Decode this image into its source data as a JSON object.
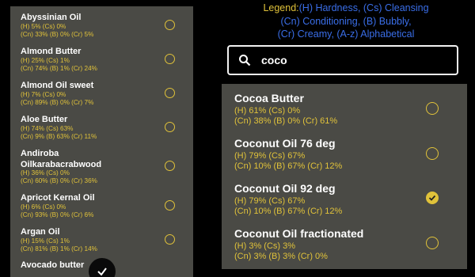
{
  "left_list": [
    {
      "name": "Abyssinian Oil",
      "line1": "(H) 5% (Cs) 0%",
      "line2": "(Cn) 33% (B) 0% (Cr) 5%"
    },
    {
      "name": "Almond Butter",
      "line1": "(H) 25% (Cs) 1%",
      "line2": "(Cn) 74% (B) 1% (Cr) 24%"
    },
    {
      "name": "Almond Oil sweet",
      "line1": "(H) 7% (Cs) 0%",
      "line2": "(Cn) 89% (B) 0% (Cr) 7%"
    },
    {
      "name": "Aloe Butter",
      "line1": "(H) 74% (Cs) 63%",
      "line2": "(Cn) 9% (B) 63% (Cr) 11%"
    },
    {
      "name": "Andiroba Oilkarabacrabwood",
      "line1": "(H) 36% (Cs) 0%",
      "line2": "(Cn) 60% (B) 0% (Cr) 36%"
    },
    {
      "name": "Apricot Kernal Oil",
      "line1": "(H) 6% (Cs) 0%",
      "line2": "(Cn) 93% (B) 0% (Cr) 6%"
    },
    {
      "name": "Argan Oil",
      "line1": "(H) 15% (Cs) 1%",
      "line2": "(Cn) 81% (B) 1% (Cr) 14%"
    },
    {
      "name": "Avocado butter",
      "line1": "",
      "line2": ""
    }
  ],
  "legend": {
    "label": "Legend:",
    "line1": "(H) Hardness, (Cs) Cleansing",
    "line2": "(Cn) Conditioning, (B) Bubbly,",
    "line3": "(Cr) Creamy, (A-z) Alphabetical"
  },
  "search": {
    "value": "coco"
  },
  "results": [
    {
      "name": "Cocoa Butter",
      "line1": "(H) 61% (Cs) 0%",
      "line2": "(Cn) 38% (B) 0% (Cr) 61%",
      "checked": false
    },
    {
      "name": "Coconut Oil 76 deg",
      "line1": "(H) 79% (Cs) 67%",
      "line2": "(Cn) 10% (B) 67% (Cr) 12%",
      "checked": false
    },
    {
      "name": "Coconut Oil 92 deg",
      "line1": "(H) 79% (Cs) 67%",
      "line2": "(Cn) 10% (B) 67% (Cr) 12%",
      "checked": true
    },
    {
      "name": "Coconut Oil fractionated",
      "line1": "(H) 3% (Cs) 3%",
      "line2": "(Cn) 3% (B) 3% (Cr) 0%",
      "checked": false
    }
  ],
  "colors": {
    "accent": "#e0c23a",
    "legend_text": "#3a6ee8",
    "panel": "#4a4a45"
  }
}
